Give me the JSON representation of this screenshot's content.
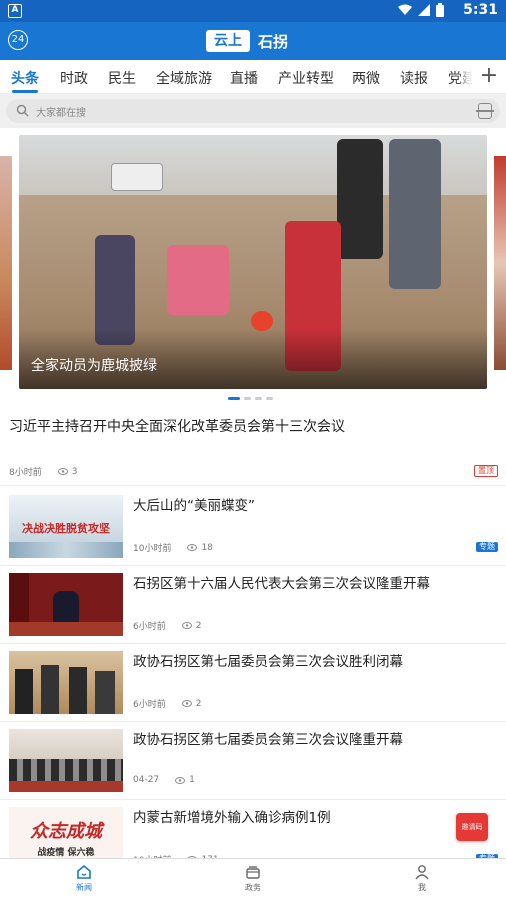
{
  "statusbar": {
    "time": "5:31",
    "left_icon": "A"
  },
  "appbar": {
    "badge": "24",
    "logo_box": "云上",
    "logo_text": "石拐"
  },
  "tabs": [
    {
      "label": "头条",
      "active": true
    },
    {
      "label": "时政"
    },
    {
      "label": "民生"
    },
    {
      "label": "全域旅游"
    },
    {
      "label": "直播"
    },
    {
      "label": "产业转型"
    },
    {
      "label": "两微"
    },
    {
      "label": "读报"
    },
    {
      "label": "党建"
    }
  ],
  "search": {
    "placeholder": "大家都在搜"
  },
  "carousel": {
    "caption": "全家动员为鹿城披绿",
    "slide_count": 4,
    "active_index": 0
  },
  "top_item": {
    "title": "习近平主持召开中央全面深化改革委员会第十三次会议",
    "time": "8小时前",
    "views": "3",
    "tag": "置顶"
  },
  "news": [
    {
      "title": "大后山的“美丽蝶变”",
      "time": "10小时前",
      "views": "18",
      "tag": "专题",
      "thumb_text": "决战决胜脱贫攻坚"
    },
    {
      "title": "石拐区第十六届人民代表大会第三次会议隆重开幕",
      "time": "6小时前",
      "views": "2"
    },
    {
      "title": "政协石拐区第七届委员会第三次会议胜利闭幕",
      "time": "6小时前",
      "views": "2"
    },
    {
      "title": "政协石拐区第七届委员会第三次会议隆重开幕",
      "time": "04-27",
      "views": "1"
    },
    {
      "title": "内蒙古新增境外输入确诊病例1例",
      "time": "10小时前",
      "views": "171",
      "tag": "专题",
      "thumb_text": "众志成城",
      "thumb_subtext": "战疫情 保六稳"
    }
  ],
  "float_button": {
    "label": "邀请码"
  },
  "bottom_nav": [
    {
      "label": "新闻",
      "icon": "home-icon",
      "active": true
    },
    {
      "label": "政务",
      "icon": "layers-icon"
    },
    {
      "label": "我",
      "icon": "person-icon"
    }
  ],
  "colors": {
    "brand": "#1976d2",
    "tag_red": "#e53935"
  }
}
